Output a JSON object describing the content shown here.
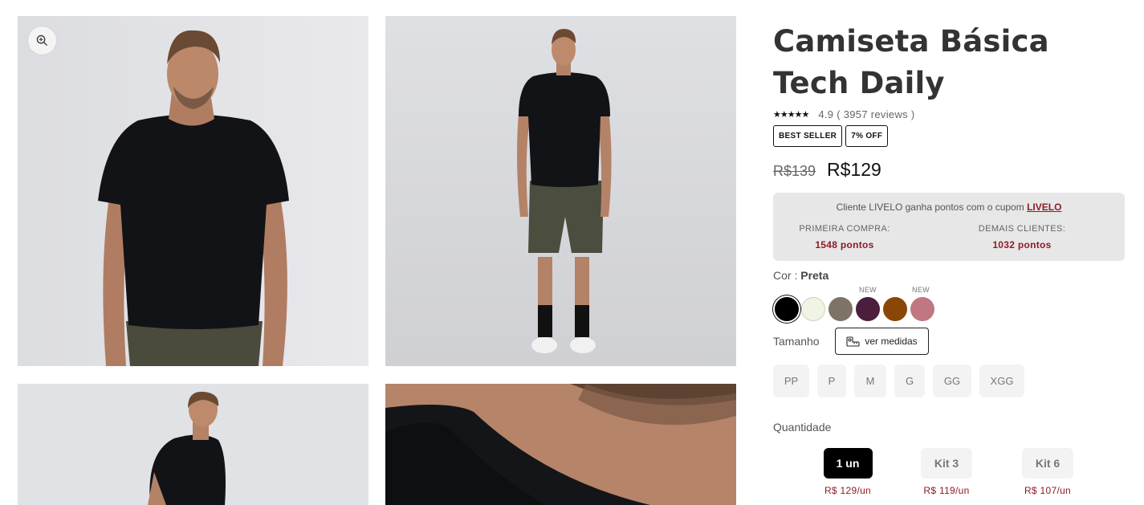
{
  "gallery": {
    "images": [
      {
        "alt": "modelo-camiseta-preta-frente"
      },
      {
        "alt": "modelo-camiseta-preta-corpo-inteiro"
      },
      {
        "alt": "modelo-camiseta-preta-costas"
      },
      {
        "alt": "detalhe-gola"
      }
    ],
    "zoom_icon": "zoom-in-icon"
  },
  "product": {
    "title": "Camiseta Básica Tech Daily",
    "stars": "★★★★★",
    "rating_text": "4.9 ( 3957 reviews )",
    "badges": [
      "BEST SELLER",
      "7% OFF"
    ],
    "old_price": "R$139",
    "price": "R$129"
  },
  "livelo": {
    "text": "Cliente LIVELO ganha pontos com o cupom ",
    "code": "LIVELO",
    "first_label": "PRIMEIRA COMPRA:",
    "first_value": "1548 pontos",
    "other_label": "DEMAIS CLIENTES:",
    "other_value": "1032 pontos"
  },
  "color": {
    "label": "Cor : ",
    "selected": "Preta",
    "new_tag": "NEW",
    "swatches": [
      {
        "hex": "#000000",
        "selected": true,
        "new": false
      },
      {
        "hex": "#f1f3e4",
        "selected": false,
        "new": false
      },
      {
        "hex": "#7d7465",
        "selected": false,
        "new": false
      },
      {
        "hex": "#4b1e3d",
        "selected": false,
        "new": true
      },
      {
        "hex": "#8a4606",
        "selected": false,
        "new": false
      },
      {
        "hex": "#c07782",
        "selected": false,
        "new": true
      }
    ]
  },
  "size": {
    "label": "Tamanho",
    "measure_button": "ver medidas",
    "measure_icon": "ruler-icon",
    "options": [
      "PP",
      "P",
      "M",
      "G",
      "GG",
      "XGG"
    ]
  },
  "quantity": {
    "label": "Quantidade",
    "options": [
      {
        "label": "1 un",
        "price": "R$ 129/un",
        "active": true
      },
      {
        "label": "Kit 3",
        "price": "R$ 119/un",
        "active": false
      },
      {
        "label": "Kit 6",
        "price": "R$ 107/un",
        "active": false
      }
    ]
  }
}
